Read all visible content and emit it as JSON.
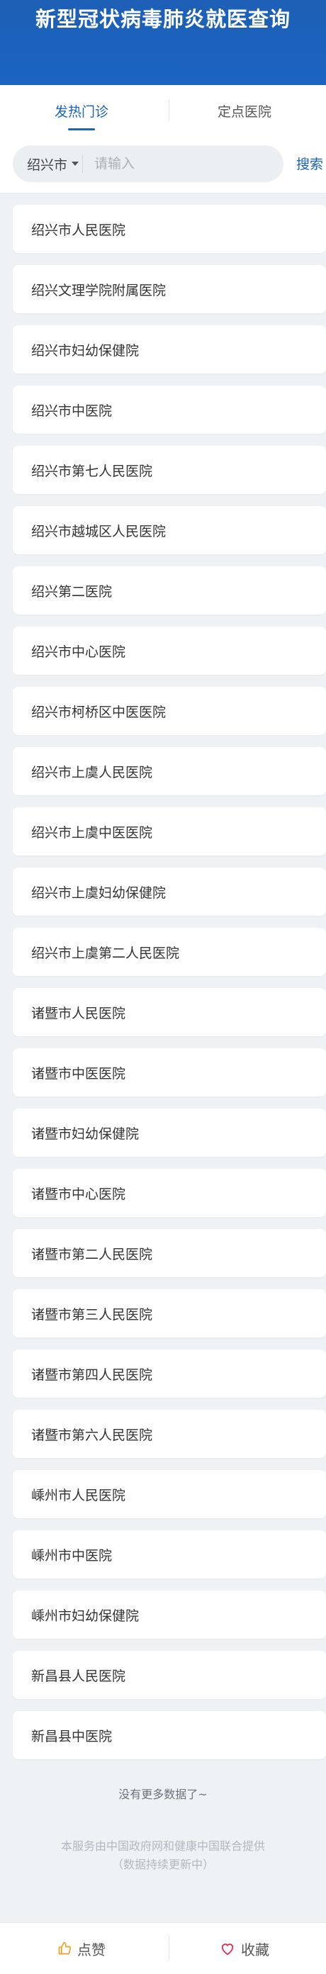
{
  "header": {
    "title": "新型冠状病毒肺炎就医查询"
  },
  "tabs": [
    {
      "label": "发热门诊",
      "active": true
    },
    {
      "label": "定点医院",
      "active": false
    }
  ],
  "search": {
    "city": "绍兴市",
    "placeholder": "请输入",
    "button_label": "搜索"
  },
  "hospitals": [
    "绍兴市人民医院",
    "绍兴文理学院附属医院",
    "绍兴市妇幼保健院",
    "绍兴市中医院",
    "绍兴市第七人民医院",
    "绍兴市越城区人民医院",
    "绍兴第二医院",
    "绍兴市中心医院",
    "绍兴市柯桥区中医医院",
    "绍兴市上虞人民医院",
    "绍兴市上虞中医医院",
    "绍兴市上虞妇幼保健院",
    "绍兴市上虞第二人民医院",
    "诸暨市人民医院",
    "诸暨市中医医院",
    "诸暨市妇幼保健院",
    "诸暨市中心医院",
    "诸暨市第二人民医院",
    "诸暨市第三人民医院",
    "诸暨市第四人民医院",
    "诸暨市第六人民医院",
    "嵊州市人民医院",
    "嵊州市中医院",
    "嵊州市妇幼保健院",
    "新昌县人民医院",
    "新昌县中医院"
  ],
  "list_end": "没有更多数据了~",
  "footer": {
    "line1": "本服务由中国政府网和健康中国联合提供",
    "line2": "（数据持续更新中）"
  },
  "bottom_bar": {
    "like_label": "点赞",
    "like_icon": "thumbs-up-icon",
    "fav_label": "收藏",
    "fav_icon": "heart-icon"
  },
  "colors": {
    "brand": "#1a63c1",
    "header_bg": "#1d5fb5",
    "accent_like": "#f0a020",
    "accent_fav": "#e0304a"
  }
}
